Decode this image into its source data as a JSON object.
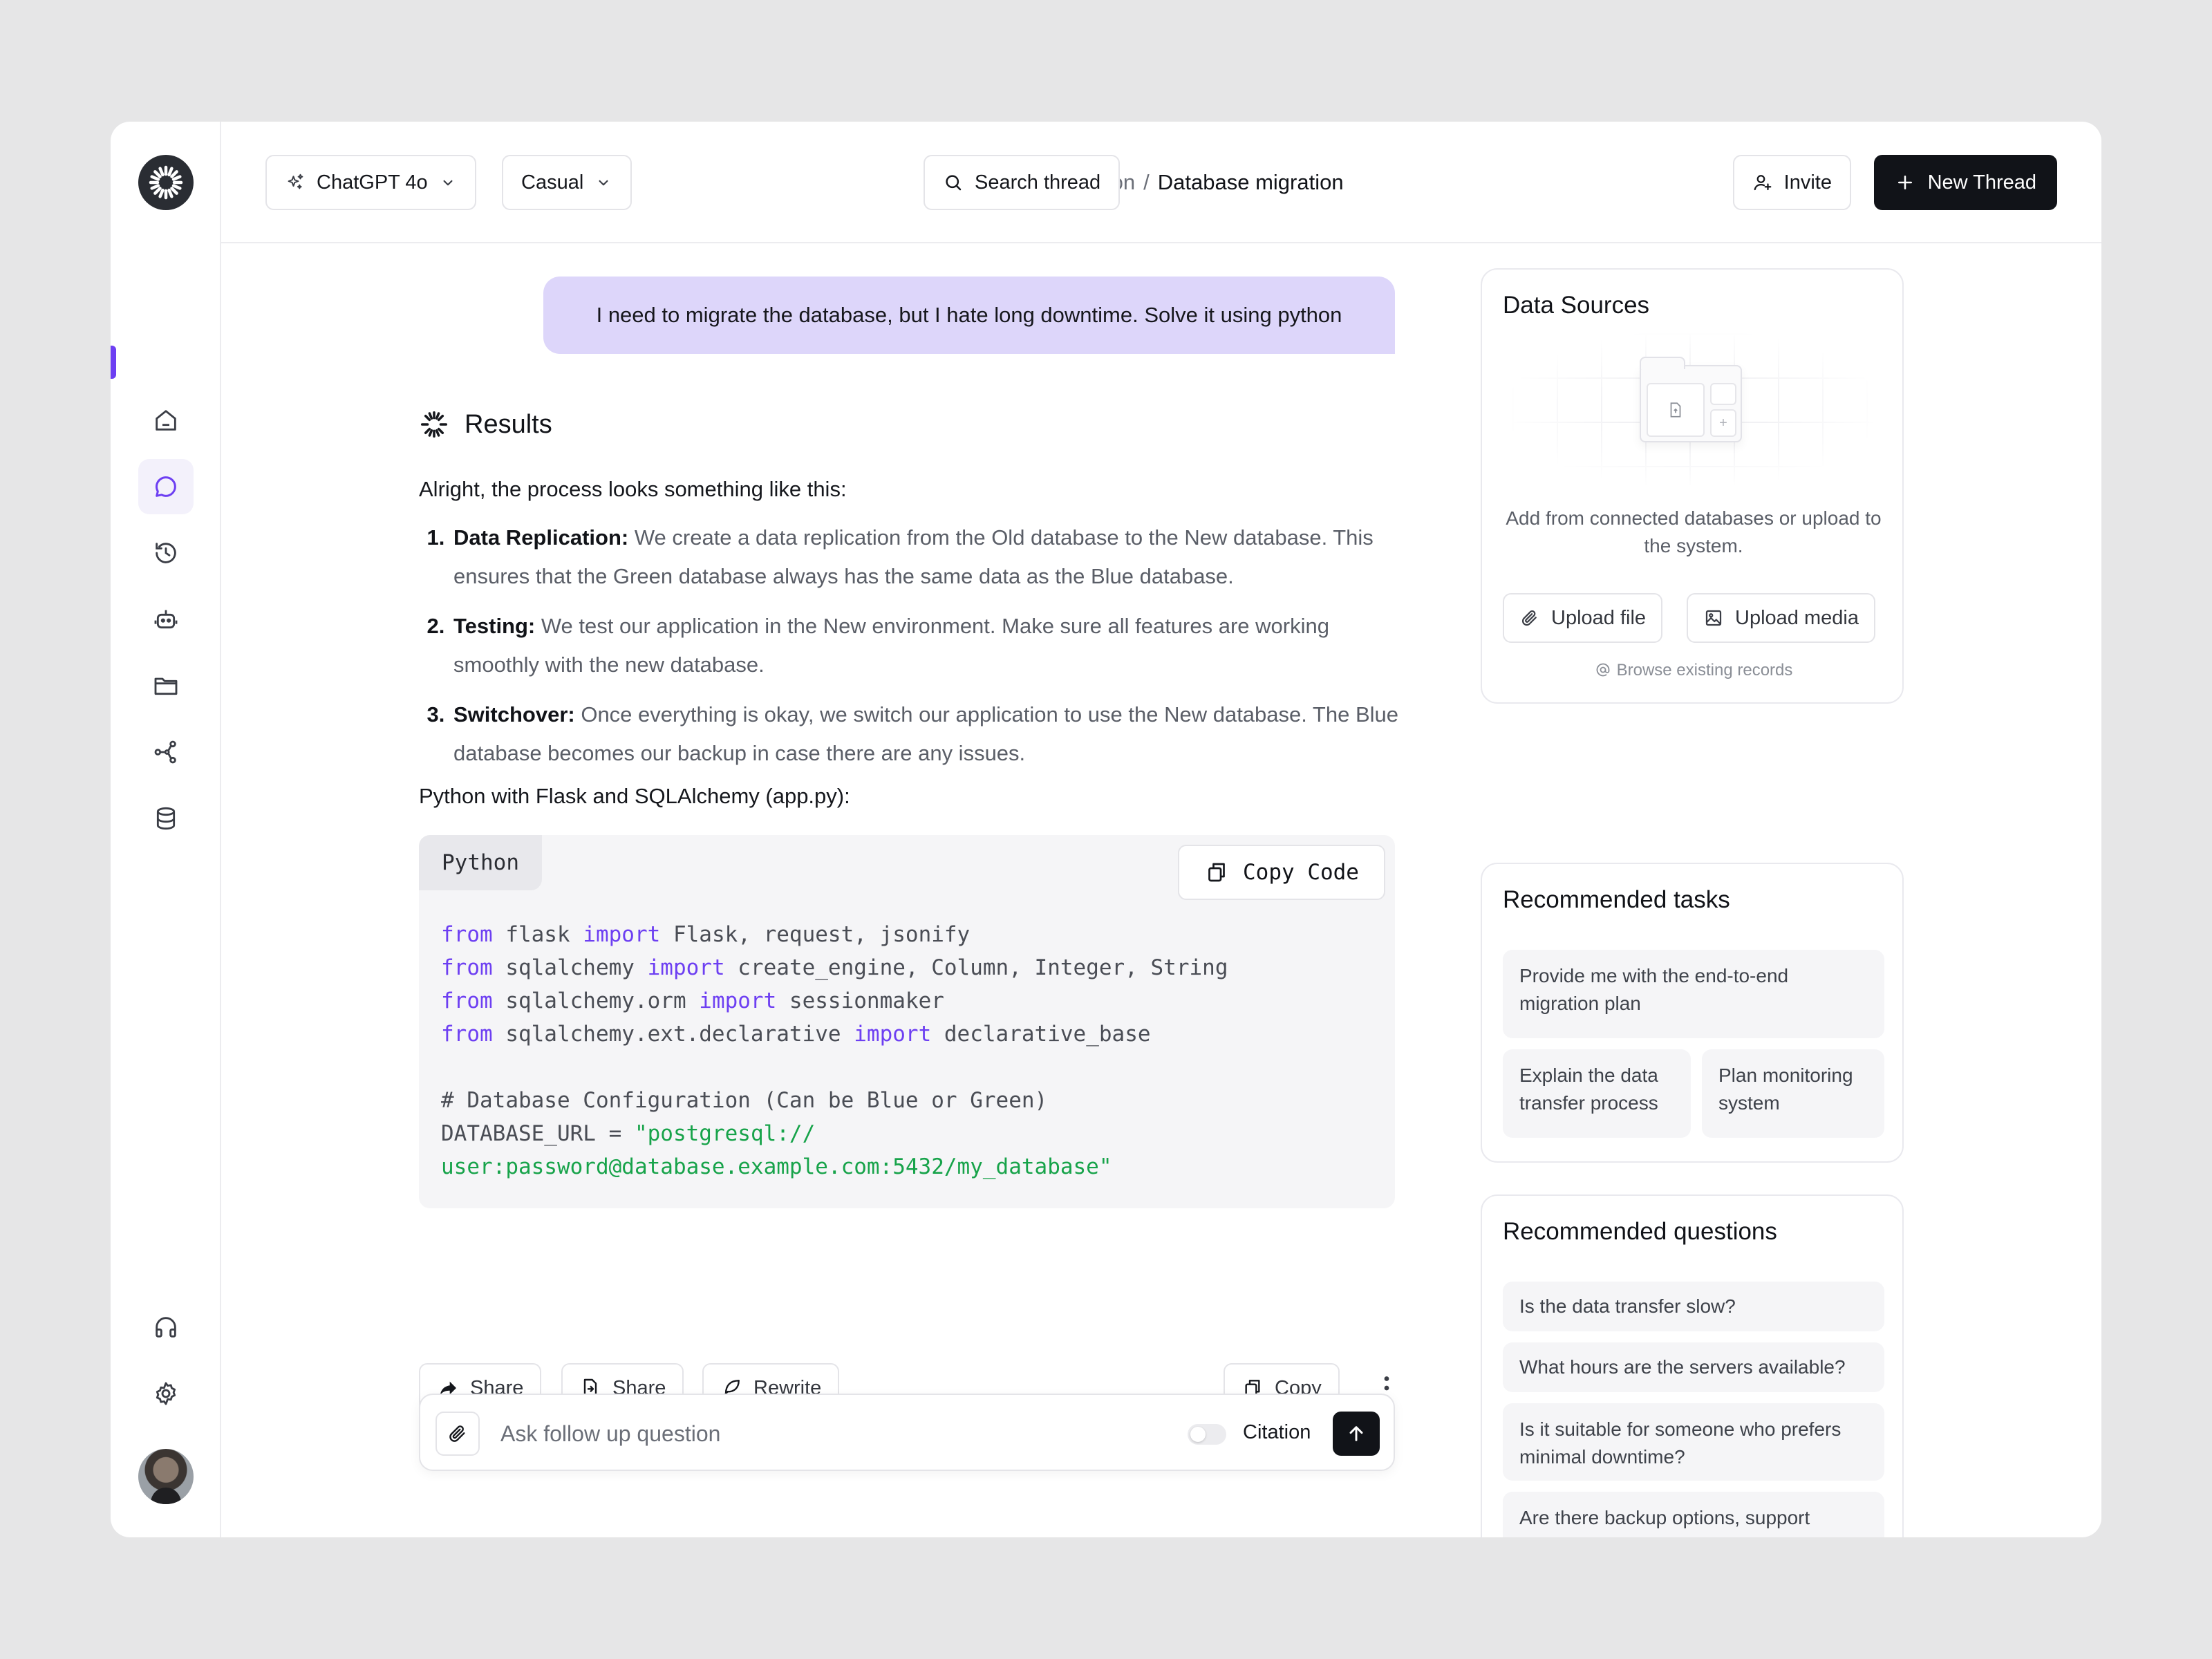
{
  "header": {
    "model_label": "ChatGPT 4o",
    "tone_label": "Casual",
    "breadcrumb_parent": "Collection",
    "breadcrumb_separator": "/",
    "breadcrumb_current": "Database migration",
    "search_label": "Search thread",
    "invite_label": "Invite",
    "new_thread_label": "New Thread"
  },
  "sidebar": {
    "items": [
      "home-icon",
      "chat-icon",
      "history-icon",
      "bot-icon",
      "folder-icon",
      "share-nodes-icon",
      "database-icon"
    ],
    "bottom": [
      "headset-icon",
      "settings-icon"
    ],
    "active_color": "#6d3ff2"
  },
  "chat": {
    "user_message": "I need to migrate the database, but I hate long downtime. Solve it using python",
    "results_title": "Results",
    "intro": "Alright, the process looks something like this:",
    "steps": [
      {
        "title": "Data Replication:",
        "text": " We create a data replication from the Old database to the New database. This ensures that the Green database always has the same data as the Blue database."
      },
      {
        "title": "Testing:",
        "text": " We test our application in the New environment. Make sure all features are working smoothly with the new database."
      },
      {
        "title": "Switchover:",
        "text": " Once everything is okay, we switch our application to use the New database. The Blue database becomes our backup in case there are any issues."
      }
    ],
    "code_intro": "Python with Flask and SQLAlchemy (app.py):",
    "code_lang": "Python",
    "copy_code_label": "Copy Code",
    "code_lines": [
      [
        {
          "t": "from",
          "c": "kw"
        },
        {
          "t": " flask "
        },
        {
          "t": "import",
          "c": "kw"
        },
        {
          "t": " Flask, request, jsonify"
        }
      ],
      [
        {
          "t": "from",
          "c": "kw"
        },
        {
          "t": " sqlalchemy "
        },
        {
          "t": "import",
          "c": "kw"
        },
        {
          "t": " create_engine, Column, Integer, String"
        }
      ],
      [
        {
          "t": "from",
          "c": "kw"
        },
        {
          "t": " sqlalchemy.orm "
        },
        {
          "t": "import",
          "c": "kw"
        },
        {
          "t": " sessionmaker"
        }
      ],
      [
        {
          "t": "from",
          "c": "kw"
        },
        {
          "t": " sqlalchemy.ext.declarative "
        },
        {
          "t": "import",
          "c": "kw"
        },
        {
          "t": " declarative_base"
        }
      ],
      [
        {
          "t": ""
        }
      ],
      [
        {
          "t": "# Database Configuration (Can be Blue or Green)"
        }
      ],
      [
        {
          "t": "DATABASE_URL = "
        },
        {
          "t": "\"postgresql://",
          "c": "str"
        }
      ],
      [
        {
          "t": "user:password@database.example.com:5432/my_database\"",
          "c": "str"
        }
      ]
    ],
    "actions": {
      "share_1": "Share",
      "share_2": "Share",
      "rewrite": "Rewrite",
      "copy": "Copy"
    },
    "composer": {
      "placeholder": "Ask follow up question",
      "citation_label": "Citation"
    }
  },
  "panel": {
    "data_sources": {
      "title": "Data Sources",
      "description": "Add from connected databases or upload to the system.",
      "upload_file": "Upload file",
      "upload_media": "Upload media",
      "browse": "Browse existing records"
    },
    "tasks": {
      "title": "Recommended tasks",
      "items": [
        "Provide me with the end-to-end migration plan",
        "Explain the data transfer process",
        "Plan monitoring system"
      ]
    },
    "questions": {
      "title": "Recommended questions",
      "items": [
        "Is the data transfer slow?",
        "What hours are the servers available?",
        "Is it suitable for someone who prefers minimal downtime?",
        "Are there backup options, support channels, and recovery areas?"
      ]
    }
  }
}
